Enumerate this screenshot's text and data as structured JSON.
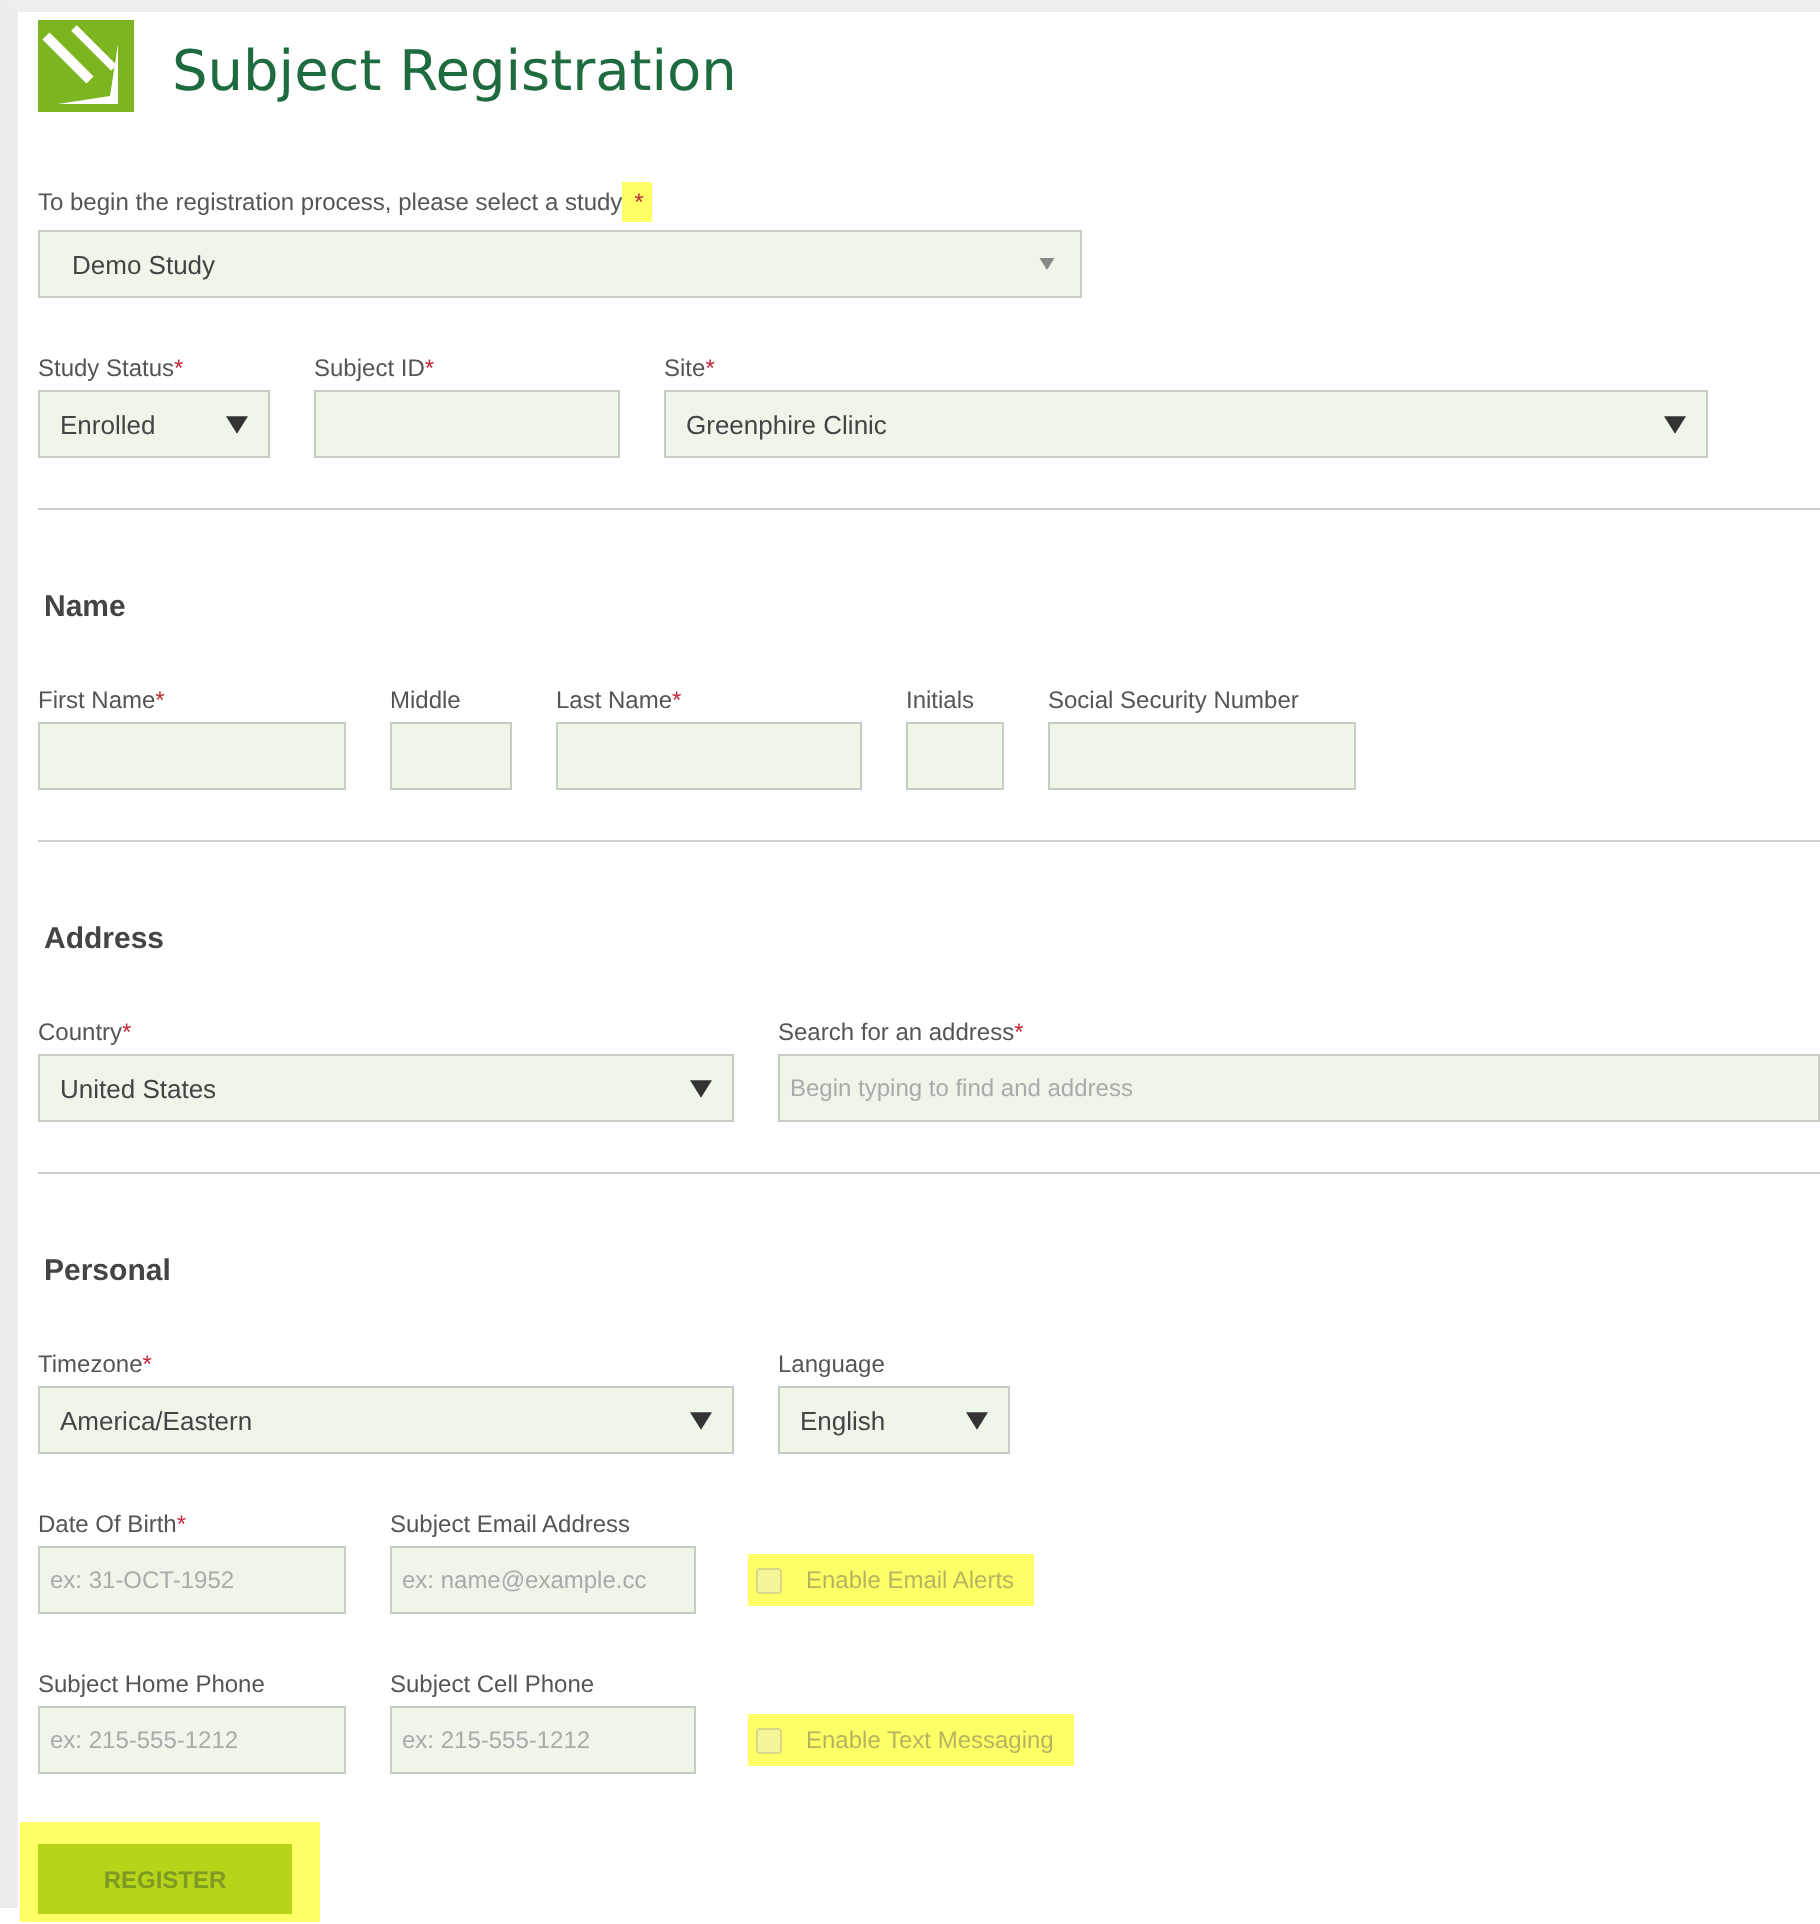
{
  "header": {
    "title": "Subject Registration"
  },
  "study": {
    "label": "To begin the registration process, please select a study",
    "required_mark": "*",
    "highlighted": true,
    "value": "Demo Study"
  },
  "top_row": [
    {
      "kind": "select",
      "label": "Study Status",
      "required_mark": "*",
      "value": "Enrolled"
    },
    {
      "kind": "text",
      "label": "Subject ID",
      "required_mark": "*"
    },
    {
      "kind": "select",
      "label": "Site",
      "required_mark": "*",
      "value": "Greenphire Clinic"
    }
  ],
  "sections": [
    {
      "title": "Name",
      "rows": [
        {
          "fields": [
            {
              "kind": "text",
              "label": "First Name",
              "required_mark": "*"
            },
            {
              "kind": "text",
              "label": "Middle"
            },
            {
              "kind": "text",
              "label": "Last Name",
              "required_mark": "*"
            },
            {
              "kind": "text",
              "label": "Initials"
            },
            {
              "kind": "text",
              "label": "Social Security Number"
            }
          ]
        }
      ]
    },
    {
      "title": "Address",
      "rows": [
        {
          "fields": [
            {
              "kind": "select",
              "label": "Country",
              "required_mark": "*",
              "value": "United States"
            },
            {
              "kind": "text",
              "label": "Search for an address",
              "required_mark": "*",
              "placeholder": "Begin typing to find and address"
            }
          ]
        }
      ]
    },
    {
      "title": "Personal",
      "rows": [
        {
          "fields": [
            {
              "kind": "select",
              "label": "Timezone",
              "required_mark": "*",
              "value": "America/Eastern"
            },
            {
              "kind": "select",
              "label": "Language",
              "value": "English"
            }
          ]
        },
        {
          "fields": [
            {
              "kind": "text",
              "label": "Date Of Birth",
              "required_mark": "*",
              "placeholder": "ex: 31-OCT-1952"
            },
            {
              "kind": "text",
              "label": "Subject Email Address",
              "placeholder": "ex: name@example.cc"
            },
            {
              "kind": "checkbox",
              "label": "Enable Email Alerts",
              "checked": false,
              "highlighted": true
            }
          ]
        },
        {
          "fields": [
            {
              "kind": "text",
              "label": "Subject Home Phone",
              "placeholder": "ex: 215-555-1212"
            },
            {
              "kind": "text",
              "label": "Subject Cell Phone",
              "placeholder": "ex: 215-555-1212"
            },
            {
              "kind": "checkbox",
              "label": "Enable Text Messaging",
              "checked": false,
              "highlighted": true
            }
          ]
        }
      ]
    }
  ],
  "register_button": {
    "label": "REGISTER",
    "highlighted": true
  }
}
